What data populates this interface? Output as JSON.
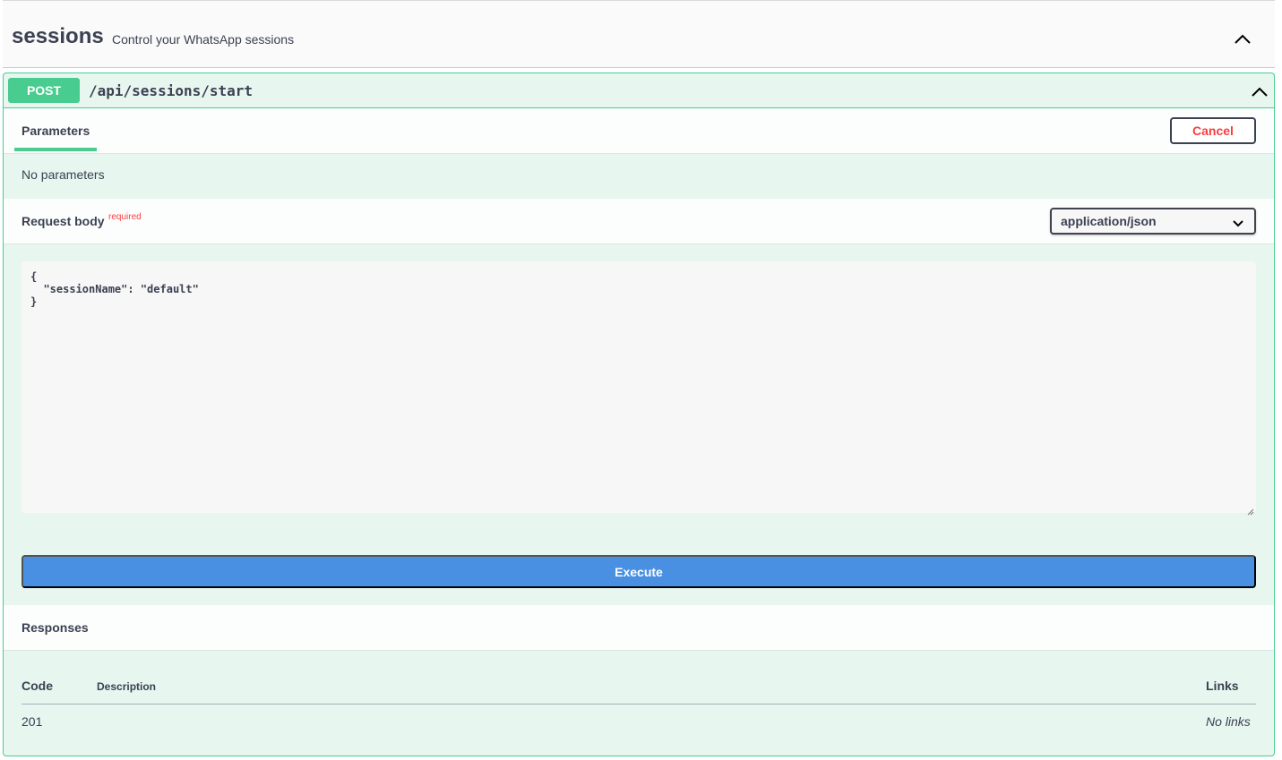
{
  "tag": {
    "name": "sessions",
    "description": "Control your WhatsApp sessions",
    "toggle_icon": "chevron-up-icon"
  },
  "operation": {
    "method": "POST",
    "path": "/api/sessions/start",
    "method_color": "#49cc90",
    "toggle_icon": "chevron-up-icon"
  },
  "parameters": {
    "tab_label": "Parameters",
    "cancel_label": "Cancel",
    "empty_text": "No parameters"
  },
  "request_body": {
    "label": "Request body",
    "required_label": "required",
    "content_type": "application/json",
    "editor_value": "{\n  \"sessionName\": \"default\"\n}"
  },
  "execute_label": "Execute",
  "responses": {
    "label": "Responses",
    "columns": [
      "Code",
      "Description",
      "Links"
    ],
    "rows": [
      {
        "code": "201",
        "description": "",
        "links": "No links"
      }
    ]
  }
}
